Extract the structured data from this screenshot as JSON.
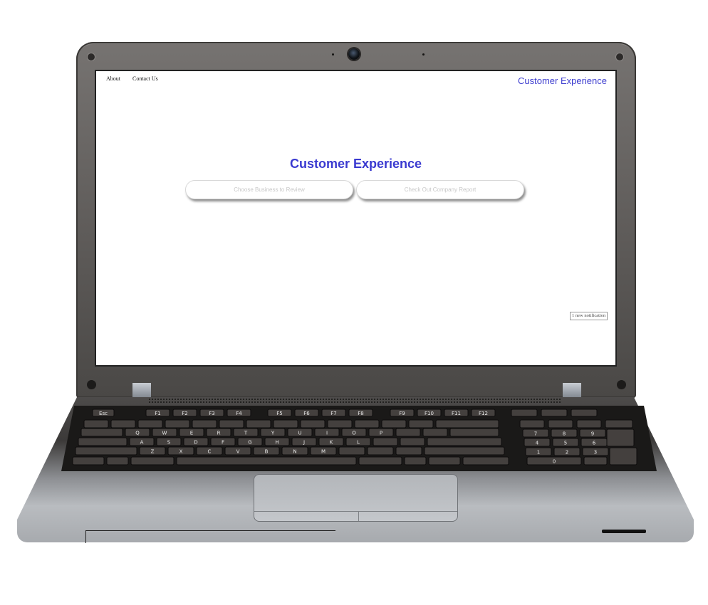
{
  "page": {
    "nav": [
      {
        "label": "About"
      },
      {
        "label": "Contact Us"
      }
    ],
    "brand": "Customer Experience",
    "hero_title": "Customer Experience",
    "buttons": [
      {
        "label": "Choose Business to Review"
      },
      {
        "label": "Check Out Company Report"
      }
    ],
    "notification": "1 new notification"
  },
  "keyboard": {
    "function_row": [
      "Esc",
      "F1",
      "F2",
      "F3",
      "F4",
      "F5",
      "F6",
      "F7",
      "F8",
      "F9",
      "F10",
      "F11",
      "F12"
    ],
    "row_q": [
      "Q",
      "W",
      "E",
      "R",
      "T",
      "Y",
      "U",
      "I",
      "O",
      "P"
    ],
    "row_a": [
      "A",
      "S",
      "D",
      "F",
      "G",
      "H",
      "J",
      "K",
      "L"
    ],
    "row_z": [
      "Z",
      "X",
      "C",
      "V",
      "B",
      "N",
      "M"
    ],
    "numpad": [
      "7",
      "8",
      "9",
      "4",
      "5",
      "6",
      "1",
      "2",
      "3",
      "0"
    ]
  },
  "colors": {
    "brand_blue": "#3d3dcf",
    "button_text": "#c8c8c8"
  }
}
